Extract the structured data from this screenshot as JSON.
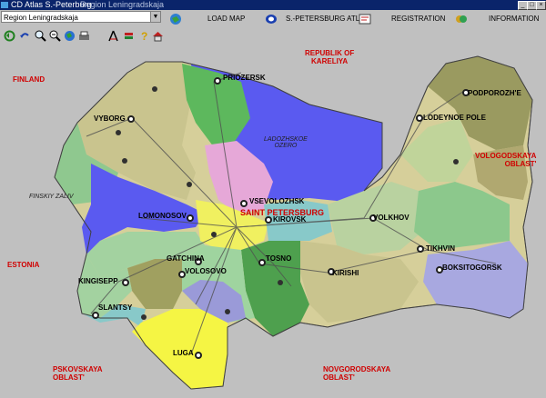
{
  "window": {
    "title": "CD Atlas S.-Peterburg",
    "subtitle": "Region Leningradskaja",
    "controls": [
      "_",
      "□",
      "×"
    ]
  },
  "toolbar": {
    "region_select": "Region Leningradskaja",
    "load_map": "LOAD MAP",
    "atlas": "S.-PETERSBURG ATLAS",
    "registration": "REGISTRATION",
    "information": "INFORMATION"
  },
  "tools": [
    "back-icon",
    "undo-icon",
    "zoom-in-icon",
    "zoom-out-icon",
    "globe-icon",
    "print-icon",
    "measure-icon",
    "layers-icon",
    "help-icon",
    "home-icon"
  ],
  "map": {
    "neighbors": {
      "finland": "FINLAND",
      "karelia": "REPUBLIK OF\nKARELIYA",
      "estonia": "ESTONIA",
      "pskov": "PSKOVSKAYA\nOBLAST'",
      "novgorod": "NOVGORODSKAYA\nOBLAST'",
      "vologda": "VOLOGODSKAYA\nOBLAST'"
    },
    "water": {
      "ladoga": "LADOZHSKOE\nOZERO",
      "gulf": "FINSKIY ZALIV"
    },
    "capital": "SAINT PETERSBURG",
    "cities": {
      "priozersk": "PRIOZERSK",
      "vyborg": "VYBORG",
      "podporozhye": "PODPOROZH'E",
      "lodeynoe": "LODEYNOE POLE",
      "vsevolozhsk": "VSEVOLOZHSK",
      "kirovsk": "KIROVSK",
      "volkhov": "VOLKHOV",
      "lomonosov": "LOMONOSOV",
      "tikhvin": "TIKHVIN",
      "gatchina": "GATCHINA",
      "volosovo": "VOLOSOVO",
      "tosno": "TOSNO",
      "kingisepp": "KINGISEPP",
      "kirishi": "KIRISHI",
      "boksitogorsk": "BOKSITOGORSK",
      "slantsy": "SLANTSY",
      "luga": "LUGA"
    }
  }
}
